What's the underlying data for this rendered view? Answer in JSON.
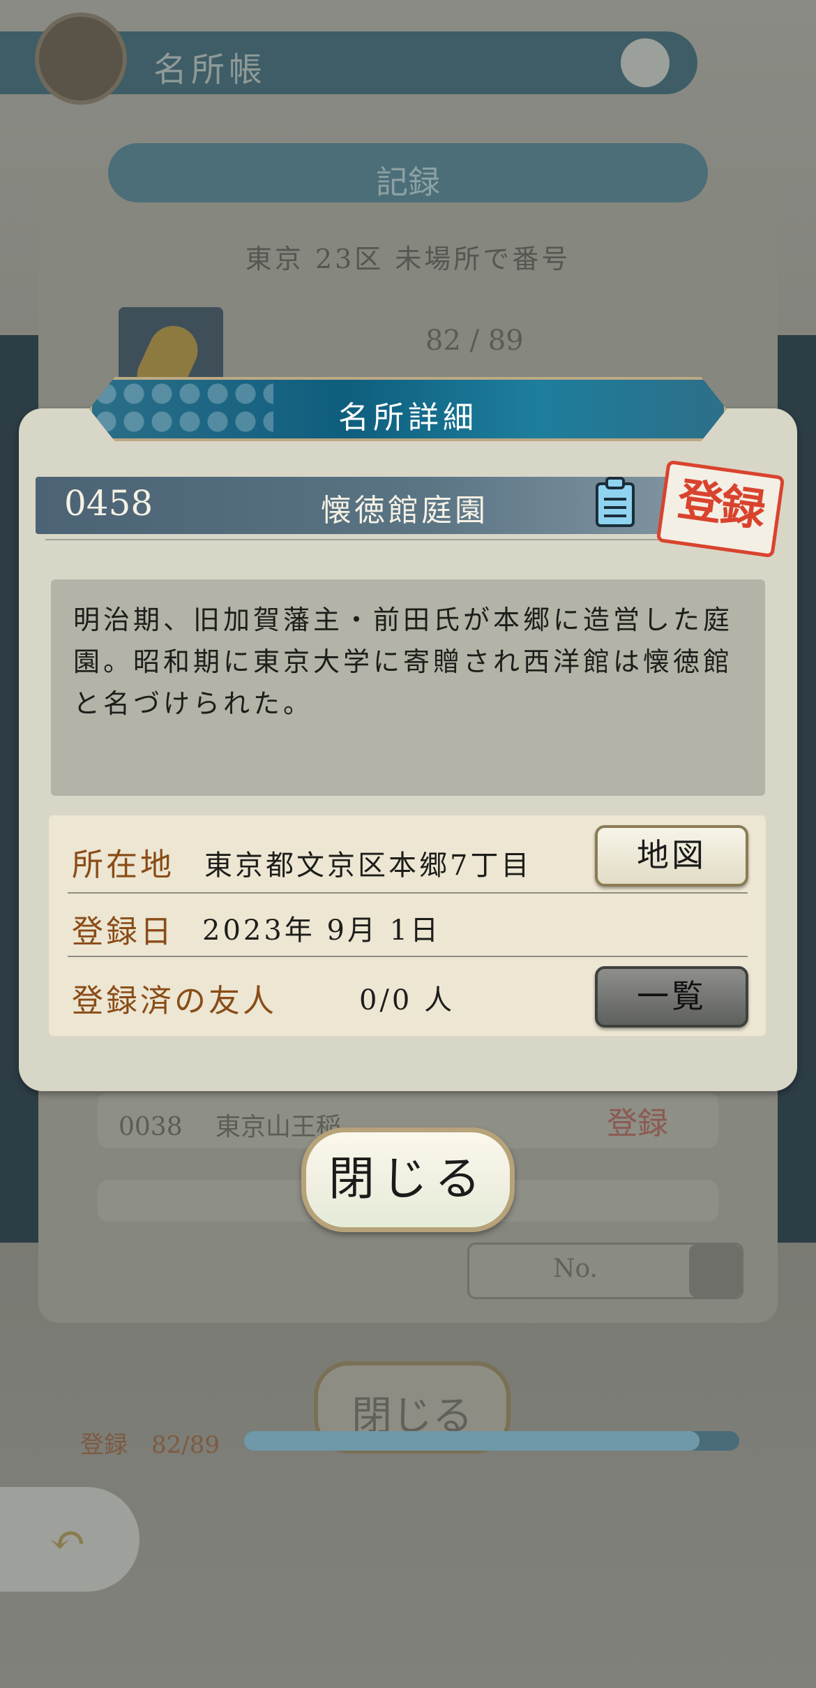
{
  "background": {
    "header_title": "名所帳",
    "banner_label": "記録",
    "subtitle": "東京 23区 未場所で番号",
    "item_count": "82 / 89",
    "rows": [
      {
        "label": "0038 　東京山王稲"
      },
      {
        "label": ""
      }
    ],
    "stamp_label": "登録",
    "filter_label": "No.",
    "close_label": "閉じる",
    "progress_label": "登録　82/89",
    "progress_fraction": 0.92
  },
  "modal": {
    "title": "名所詳細",
    "entry": {
      "number": "0458",
      "name": "懐徳館庭園",
      "stamp": "登録"
    },
    "description": "明治期、旧加賀藩主・前田氏が本郷に造営した庭園。昭和期に東京大学に寄贈され西洋館は懐徳館と名づけられた。",
    "info": {
      "location_label": "所在地",
      "location_value": "東京都文京区本郷7丁目",
      "map_button": "地図",
      "date_label": "登録日",
      "date_value": "2023年 9月 1日",
      "friends_label": "登録済の友人",
      "friends_value": "0/0 人",
      "list_button": "一覧"
    },
    "close_button": "閉じる"
  },
  "colors": {
    "header_teal": "#0f5e7e",
    "label_brown": "#8a4c17",
    "stamp_red": "#d9432e",
    "panel_beige": "#d8d6c6"
  }
}
